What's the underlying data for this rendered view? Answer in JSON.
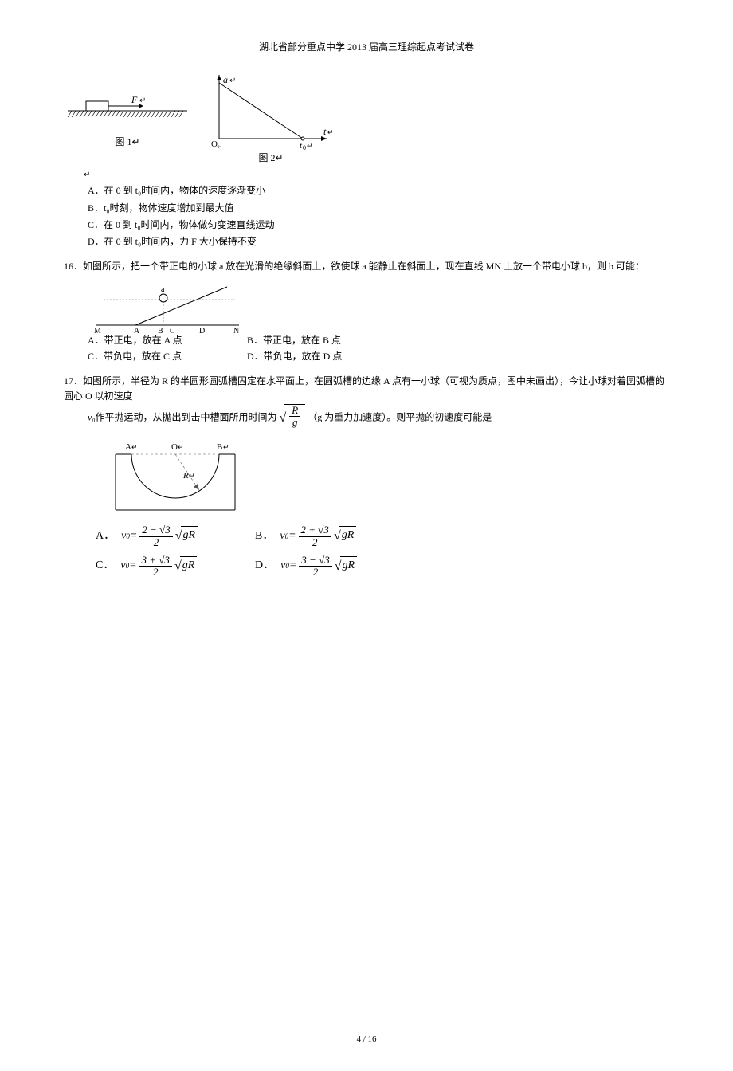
{
  "header": "湖北省部分重点中学 2013 届高三理综起点考试试卷",
  "fig1_label": "图 1",
  "fig2_label": "图 2",
  "q15": {
    "optA": "A．在 0 到 t₀时间内，物体的速度逐渐变小",
    "optB": "B．t₀时刻，物体速度增加到最大值",
    "optC": "C．在 0 到 t₀时间内，物体做匀变速直线运动",
    "optD": "D．在 0 到 t₀时间内，力 F 大小保持不变"
  },
  "q16": {
    "num": "16．",
    "text": "如图所示，把一个带正电的小球 a 放在光滑的绝缘斜面上，欲使球 a 能静止在斜面上，现在直线 MN 上放一个带电小球 b，则 b 可能：",
    "optA": "A．带正电，放在 A 点",
    "optB": "B．带正电，放在 B 点",
    "optC": "C．带负电，放在 C 点",
    "optD": "D．带负电，放在 D 点"
  },
  "q17": {
    "num": "17．",
    "text_part1": "如图所示，半径为 R 的半圆形圆弧槽固定在水平面上，在圆弧槽的边缘 A 点有一小球（可视为质点，图中未画出），今让小球对着圆弧槽的圆心 O 以初速度 ",
    "v0": "v₀",
    "text_part2": "作平抛运动，从抛出到击中槽面所用时间为",
    "text_part3": "（g 为重力加速度）。则平抛的初速度可能是"
  },
  "footer": "4 / 16"
}
